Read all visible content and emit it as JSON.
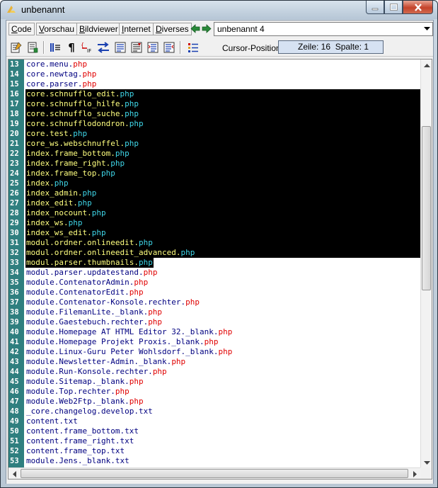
{
  "window": {
    "title": "unbenannt"
  },
  "menu": {
    "items": [
      {
        "prefix": "",
        "u": "C",
        "rest": "ode"
      },
      {
        "prefix": "",
        "u": "V",
        "rest": "orschau"
      },
      {
        "prefix": "",
        "u": "B",
        "rest": "ildviewer"
      },
      {
        "prefix": "",
        "u": "I",
        "rest": "nternet"
      },
      {
        "prefix": "",
        "u": "D",
        "rest": "iverses"
      }
    ],
    "file_select_value": "unbenannt 4"
  },
  "toolbar": {
    "cursor_label": "Cursor-Position:",
    "cursor_value": "Zeile: 16  Spalte: 1"
  },
  "editor": {
    "lines": [
      {
        "n": "13",
        "name": "core.menu.",
        "ext": "php",
        "sel": false
      },
      {
        "n": "14",
        "name": "core.newtag.",
        "ext": "php",
        "sel": false
      },
      {
        "n": "15",
        "name": "core.parser.",
        "ext": "php",
        "sel": false
      },
      {
        "n": "16",
        "name": "core.schnufflo_edit.",
        "ext": "php",
        "sel": true
      },
      {
        "n": "17",
        "name": "core.schnufflo_hilfe.",
        "ext": "php",
        "sel": true
      },
      {
        "n": "18",
        "name": "core.schnufflo_suche.",
        "ext": "php",
        "sel": true
      },
      {
        "n": "19",
        "name": "core.schnufflodondron.",
        "ext": "php",
        "sel": true
      },
      {
        "n": "20",
        "name": "core.test.",
        "ext": "php",
        "sel": true
      },
      {
        "n": "21",
        "name": "core_ws.webschnuffel.",
        "ext": "php",
        "sel": true
      },
      {
        "n": "22",
        "name": "index.frame_bottom.",
        "ext": "php",
        "sel": true
      },
      {
        "n": "23",
        "name": "index.frame_right.",
        "ext": "php",
        "sel": true
      },
      {
        "n": "24",
        "name": "index.frame_top.",
        "ext": "php",
        "sel": true
      },
      {
        "n": "25",
        "name": "index.",
        "ext": "php",
        "sel": true
      },
      {
        "n": "26",
        "name": "index_admin.",
        "ext": "php",
        "sel": true
      },
      {
        "n": "27",
        "name": "index_edit.",
        "ext": "php",
        "sel": true
      },
      {
        "n": "28",
        "name": "index_nocount.",
        "ext": "php",
        "sel": true
      },
      {
        "n": "29",
        "name": "index_ws.",
        "ext": "php",
        "sel": true
      },
      {
        "n": "30",
        "name": "index_ws_edit.",
        "ext": "php",
        "sel": true
      },
      {
        "n": "31",
        "name": "modul.ordner.onlineedit.",
        "ext": "php",
        "sel": true
      },
      {
        "n": "32",
        "name": "modul.ordner.onlineedit_advanced.",
        "ext": "php",
        "sel": true
      },
      {
        "n": "33",
        "name": "modul.parser.thumbnails.",
        "ext": "php",
        "sel": true,
        "partial": true
      },
      {
        "n": "34",
        "name": "modul.parser.updatestand.",
        "ext": "php",
        "sel": false
      },
      {
        "n": "35",
        "name": "module.ContenatorAdmin.",
        "ext": "php",
        "sel": false
      },
      {
        "n": "36",
        "name": "module.ContenatorEdit.",
        "ext": "php",
        "sel": false
      },
      {
        "n": "37",
        "name": "module.Contenator-Konsole.rechter.",
        "ext": "php",
        "sel": false
      },
      {
        "n": "38",
        "name": "module.FilemanLite._blank.",
        "ext": "php",
        "sel": false
      },
      {
        "n": "39",
        "name": "module.Gaestebuch.rechter.",
        "ext": "php",
        "sel": false
      },
      {
        "n": "40",
        "name": "module.Homepage AT HTML Editor 32._blank.",
        "ext": "php",
        "sel": false
      },
      {
        "n": "41",
        "name": "module.Homepage Projekt Proxis._blank.",
        "ext": "php",
        "sel": false
      },
      {
        "n": "42",
        "name": "module.Linux-Guru Peter Wohlsdorf._blank.",
        "ext": "php",
        "sel": false
      },
      {
        "n": "43",
        "name": "module.Newsletter-Admin._blank.",
        "ext": "php",
        "sel": false
      },
      {
        "n": "44",
        "name": "module.Run-Konsole.rechter.",
        "ext": "php",
        "sel": false
      },
      {
        "n": "45",
        "name": "module.Sitemap._blank.",
        "ext": "php",
        "sel": false
      },
      {
        "n": "46",
        "name": "module.Top.rechter.",
        "ext": "php",
        "sel": false
      },
      {
        "n": "47",
        "name": "module.Web2Ftp._blank.",
        "ext": "php",
        "sel": false
      },
      {
        "n": "48",
        "name": "_core.changelog.develop.txt",
        "ext": "",
        "sel": false
      },
      {
        "n": "49",
        "name": "content.txt",
        "ext": "",
        "sel": false
      },
      {
        "n": "50",
        "name": "content.frame_bottom.txt",
        "ext": "",
        "sel": false
      },
      {
        "n": "51",
        "name": "content.frame_right.txt",
        "ext": "",
        "sel": false
      },
      {
        "n": "52",
        "name": "content.frame_top.txt",
        "ext": "",
        "sel": false
      },
      {
        "n": "53",
        "name": "module.Jens._blank.txt",
        "ext": "",
        "sel": false
      }
    ]
  },
  "colors": {
    "gutter": "#2f7f7f",
    "selection_bg": "#000000",
    "selection_text": "#ffff7f",
    "php_ext": "#e00000",
    "php_ext_selected": "#3fd6e8"
  }
}
